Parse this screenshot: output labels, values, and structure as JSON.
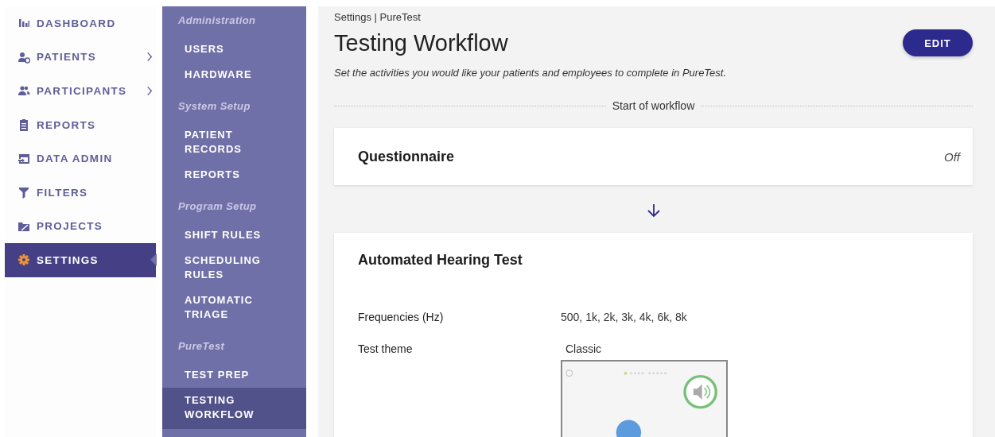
{
  "nav": [
    {
      "label": "DASHBOARD",
      "selected": false,
      "has_submenu": false
    },
    {
      "label": "PATIENTS",
      "selected": false,
      "has_submenu": true
    },
    {
      "label": "PARTICIPANTS",
      "selected": false,
      "has_submenu": true
    },
    {
      "label": "REPORTS",
      "selected": false,
      "has_submenu": false
    },
    {
      "label": "DATA ADMIN",
      "selected": false,
      "has_submenu": false
    },
    {
      "label": "FILTERS",
      "selected": false,
      "has_submenu": false
    },
    {
      "label": "PROJECTS",
      "selected": false,
      "has_submenu": false
    },
    {
      "label": "SETTINGS",
      "selected": true,
      "has_submenu": false
    }
  ],
  "submenu": [
    {
      "heading": "Administration",
      "items": [
        {
          "label": "USERS",
          "selected": false
        },
        {
          "label": "HARDWARE",
          "selected": false
        }
      ]
    },
    {
      "heading": "System Setup",
      "items": [
        {
          "label": "PATIENT RECORDS",
          "selected": false
        },
        {
          "label": "REPORTS",
          "selected": false
        }
      ]
    },
    {
      "heading": "Program Setup",
      "items": [
        {
          "label": "SHIFT RULES",
          "selected": false
        },
        {
          "label": "SCHEDULING RULES",
          "selected": false
        },
        {
          "label": "AUTOMATIC TRIAGE",
          "selected": false
        }
      ]
    },
    {
      "heading": "PureTest",
      "items": [
        {
          "label": "TEST PREP",
          "selected": false
        },
        {
          "label": "TESTING WORKFLOW",
          "selected": true
        }
      ]
    }
  ],
  "breadcrumb": "Settings | PureTest",
  "title": "Testing Workflow",
  "edit_button": "EDIT",
  "description": "Set the activities you would like your patients and employees to complete in PureTest.",
  "workflow_start": "Start of workflow",
  "steps": [
    {
      "title": "Questionnaire",
      "status": "Off"
    },
    {
      "title": "Automated Hearing Test",
      "fields": [
        {
          "label": "Frequencies (Hz)",
          "value": "500, 1k, 2k, 3k, 4k, 6k, 8k",
          "kind": "text"
        },
        {
          "label": "Test theme",
          "value": "Classic",
          "kind": "preview"
        }
      ]
    }
  ]
}
